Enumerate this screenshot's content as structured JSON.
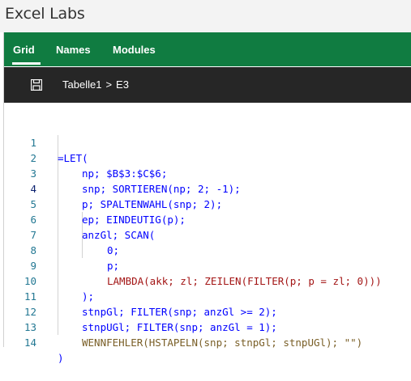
{
  "app": {
    "title": "Excel Labs"
  },
  "tabs": [
    {
      "label": "Grid",
      "active": true
    },
    {
      "label": "Names",
      "active": false
    },
    {
      "label": "Modules",
      "active": false
    }
  ],
  "toolbar": {
    "save_icon": "save-icon"
  },
  "breadcrumb": {
    "sheet": "Tabelle1",
    "separator": ">",
    "cell": "E3"
  },
  "editor": {
    "current_line": 4,
    "lines": [
      {
        "n": "1",
        "text": "=LET("
      },
      {
        "n": "2",
        "text": "np; $B$3:$C$6;"
      },
      {
        "n": "3",
        "text": "snp; SORTIEREN(np; 2; -1);"
      },
      {
        "n": "4",
        "text": "p; SPALTENWAHL(snp; 2);"
      },
      {
        "n": "5",
        "text": "ep; EINDEUTIG(p);"
      },
      {
        "n": "6",
        "text": "anzGl; SCAN("
      },
      {
        "n": "7",
        "text": "0;"
      },
      {
        "n": "8",
        "text": "p;"
      },
      {
        "n": "9",
        "text": "LAMBDA(akk; zl; ZEILEN(FILTER(p; p = zl; 0)))"
      },
      {
        "n": "10",
        "text": ");"
      },
      {
        "n": "11",
        "text": "stnpGl; FILTER(snp; anzGl >= 2);"
      },
      {
        "n": "12",
        "text": "stnpUGl; FILTER(snp; anzGl = 1);"
      },
      {
        "n": "13",
        "text": "WENNFEHLER(HSTAPELN(snp; stnpGl; stnpUGl); \"\")"
      },
      {
        "n": "14",
        "text": ")"
      }
    ]
  },
  "colors": {
    "tabbar": "#107c41",
    "crumbbar": "#262626",
    "code": "#0000ff",
    "function": "#795e26",
    "lambda": "#a31515",
    "line_number": "#237893"
  }
}
